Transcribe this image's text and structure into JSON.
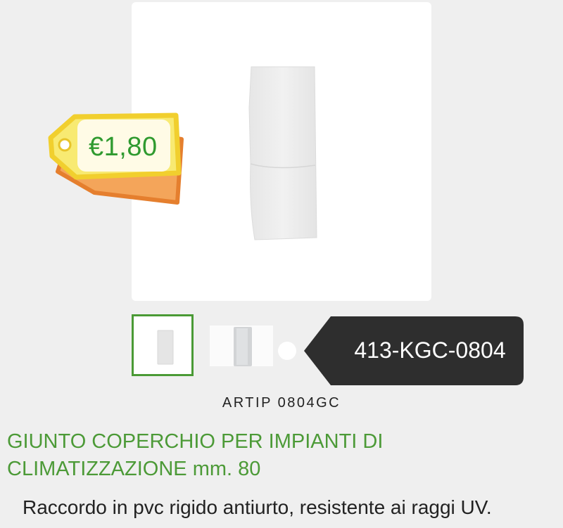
{
  "price": {
    "label": "€1,80"
  },
  "thumbnails": {
    "selected_index": 0
  },
  "sku_badge": {
    "code": "413-KGC-0804"
  },
  "product": {
    "code": "ARTIP 0804GC",
    "title": "GIUNTO COPERCHIO PER IMPIANTI DI CLIMATIZZAZIONE mm. 80",
    "description": "Raccordo in pvc rigido antiurto, resistente ai raggi UV."
  },
  "colors": {
    "accent_green": "#4c9a37",
    "price_green": "#2f9a2f",
    "badge_dark": "#2e2e2e",
    "tag_yellow": "#f5e36a",
    "tag_orange": "#e8893a"
  }
}
